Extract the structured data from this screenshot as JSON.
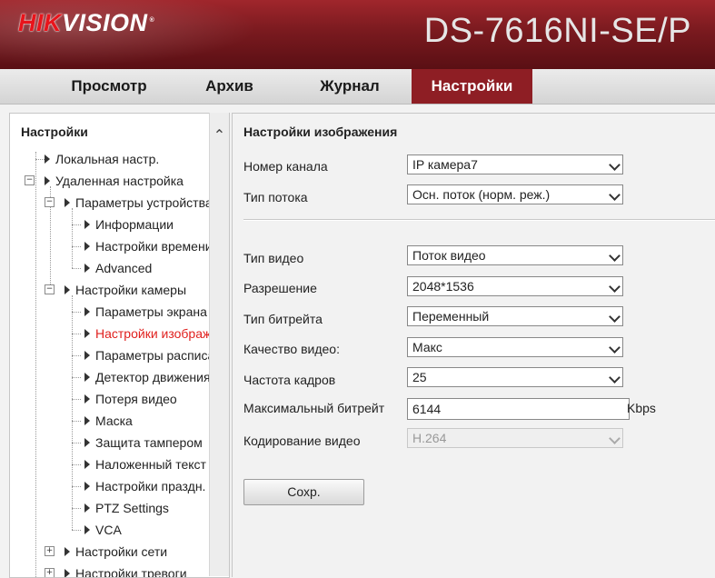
{
  "header": {
    "logo_prefix": "HIK",
    "logo_suffix": "VISION",
    "logo_mark": "®",
    "model": "DS-7616NI-SE/P"
  },
  "nav": {
    "tabs": [
      {
        "label": "Просмотр"
      },
      {
        "label": "Архив"
      },
      {
        "label": "Журнал"
      },
      {
        "label": "Настройки",
        "active": true
      }
    ]
  },
  "sidebar": {
    "title": "Настройки",
    "items": [
      {
        "label": "Локальная настр."
      },
      {
        "label": "Удаленная настройка",
        "expander": "−"
      },
      {
        "label": "Параметры устройства",
        "expander": "−"
      },
      {
        "label": "Информации"
      },
      {
        "label": "Настройки времени"
      },
      {
        "label": "Advanced"
      },
      {
        "label": "Настройки камеры",
        "expander": "−"
      },
      {
        "label": "Параметры экрана"
      },
      {
        "label": "Настройки изображения",
        "selected": true
      },
      {
        "label": "Параметры расписания"
      },
      {
        "label": "Детектор движения"
      },
      {
        "label": "Потеря видео"
      },
      {
        "label": "Маска"
      },
      {
        "label": "Защита тампером"
      },
      {
        "label": "Наложенный текст"
      },
      {
        "label": "Настройки праздн."
      },
      {
        "label": "PTZ Settings"
      },
      {
        "label": "VCA"
      },
      {
        "label": "Настройки сети",
        "expander": "+"
      },
      {
        "label": "Настройки тревоги",
        "expander": "+"
      }
    ],
    "scroll_up_glyph": "⌃"
  },
  "main": {
    "title": "Настройки изображения",
    "fields": {
      "channel": {
        "label": "Номер канала",
        "value": "IP камера7"
      },
      "stream_type": {
        "label": "Тип потока",
        "value": "Осн. поток (норм. реж.)"
      },
      "video_type": {
        "label": "Тип видео",
        "value": "Поток видео"
      },
      "resolution": {
        "label": "Разрешение",
        "value": "2048*1536"
      },
      "bitrate_type": {
        "label": "Тип битрейта",
        "value": "Переменный"
      },
      "video_quality": {
        "label": "Качество видео:",
        "value": "Макс"
      },
      "frame_rate": {
        "label": "Частота кадров",
        "value": "25"
      },
      "max_bitrate": {
        "label": "Максимальный битрейт",
        "value": "6144",
        "unit": "Kbps"
      },
      "video_encoding": {
        "label": "Кодирование видео",
        "value": "H.264",
        "disabled": true
      }
    },
    "save_label": "Сохр."
  },
  "colors": {
    "header_red": "#8e1e24",
    "active_tab": "#8e1e24",
    "selected_item": "#e0201e"
  }
}
